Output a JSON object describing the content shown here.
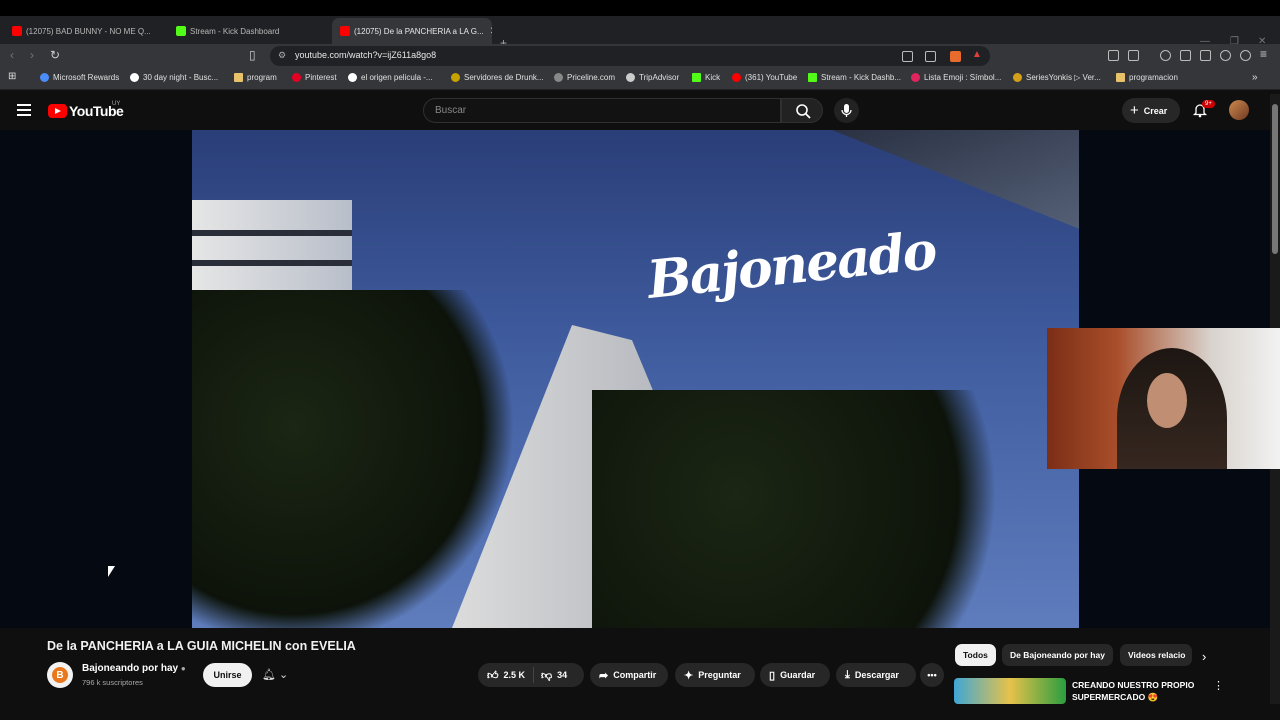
{
  "browser": {
    "tabs": [
      {
        "label": "(12075) BAD BUNNY - NO ME Q...",
        "fav_color": "#ff0000"
      },
      {
        "label": "Stream - Kick Dashboard",
        "fav_color": "#53fc18"
      },
      {
        "label": "(12075) De la PANCHERIA a LA G...",
        "fav_color": "#ff0000",
        "active": true
      }
    ],
    "url": "youtube.com/watch?v=ijZ611a8go8",
    "bookmarks": [
      {
        "label": "Microsoft Rewards",
        "color": "#4b8df8"
      },
      {
        "label": "30 day night - Busc...",
        "color": "#ffffff"
      },
      {
        "label": "program",
        "color": "#e8c26a"
      },
      {
        "label": "Pinterest",
        "color": "#e60023"
      },
      {
        "label": "el origen pelicula -...",
        "color": "#ffffff"
      },
      {
        "label": "Servidores de Drunk...",
        "color": "#c8a200"
      },
      {
        "label": "Priceline.com",
        "color": "#888888"
      },
      {
        "label": "TripAdvisor",
        "color": "#cccccc"
      },
      {
        "label": "Kick",
        "color": "#53fc18"
      },
      {
        "label": "(361) YouTube",
        "color": "#ff0000"
      },
      {
        "label": "Stream - Kick Dashb...",
        "color": "#53fc18"
      },
      {
        "label": "Lista Emoji : Símbol...",
        "color": "#e0245e"
      },
      {
        "label": "SeriesYonkis ▷ Ver...",
        "color": "#d4a017"
      },
      {
        "label": "programacion",
        "color": "#e8c26a"
      }
    ]
  },
  "youtube": {
    "logo_text": "YouTube",
    "country": "UY",
    "search_placeholder": "Buscar",
    "create_label": "Crear",
    "notif_badge": "9+",
    "video_logo_text": "Bajoneado"
  },
  "video": {
    "title": "De la PANCHERIA a LA GUIA MICHELIN con EVELIA",
    "channel": "Bajoneando por hay",
    "subscribers": "796 k suscriptores",
    "join_label": "Unirse",
    "likes": "2.5 K",
    "dislikes": "34",
    "share_label": "Compartir",
    "ask_label": "Preguntar",
    "save_label": "Guardar",
    "download_label": "Descargar"
  },
  "sidebar": {
    "chips": [
      "Todos",
      "De Bajoneando por hay",
      "Videos relacio"
    ],
    "related": [
      {
        "title": "CREANDO NUESTRO PROPIO SUPERMERCADO 😍"
      }
    ]
  }
}
